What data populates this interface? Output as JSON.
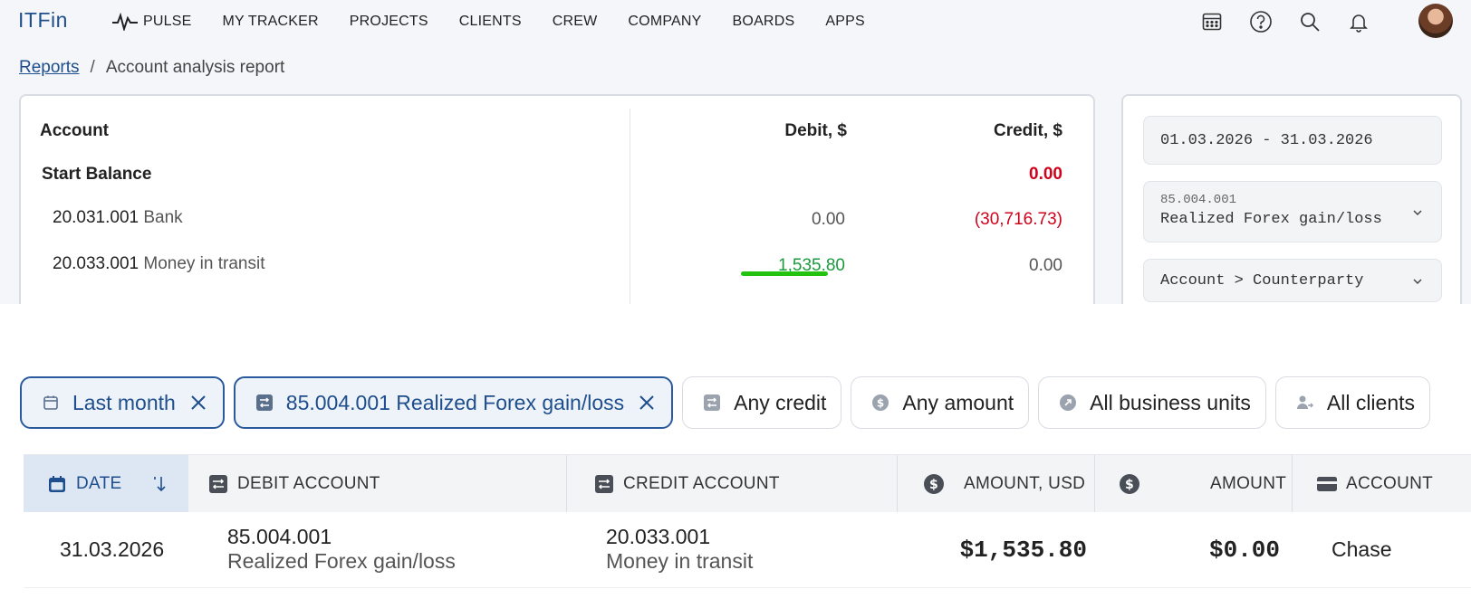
{
  "nav": {
    "logo": "ITFin",
    "items": [
      "PULSE",
      "MY TRACKER",
      "PROJECTS",
      "CLIENTS",
      "CREW",
      "COMPANY",
      "BOARDS",
      "APPS"
    ]
  },
  "breadcrumb": {
    "parent": "Reports",
    "separator": "/",
    "current": "Account analysis report"
  },
  "report": {
    "headers": {
      "account": "Account",
      "debit": "Debit, $",
      "credit": "Credit, $"
    },
    "start_balance": {
      "label": "Start Balance",
      "credit": "0.00"
    },
    "rows": [
      {
        "code": "20.031.001",
        "name": "Bank",
        "debit": "0.00",
        "credit": "(30,716.73)"
      },
      {
        "code": "20.033.001",
        "name": "Money in transit",
        "debit": "1,535.80",
        "credit": "0.00"
      }
    ]
  },
  "filters_panel": {
    "period": "01.03.2026 - 31.03.2026",
    "account_code": "85.004.001",
    "account_name": "Realized Forex gain/loss",
    "grouping": "Account > Counterparty"
  },
  "chips": [
    {
      "label": "Last month",
      "active": true,
      "icon": "calendar-icon"
    },
    {
      "label": "85.004.001 Realized Forex gain/loss",
      "active": true,
      "icon": "transfer-icon"
    },
    {
      "label": "Any credit",
      "active": false,
      "icon": "transfer-icon"
    },
    {
      "label": "Any amount",
      "active": false,
      "icon": "dollar-icon"
    },
    {
      "label": "All business units",
      "active": false,
      "icon": "arrow-circle-icon"
    },
    {
      "label": "All clients",
      "active": false,
      "icon": "users-icon"
    }
  ],
  "table": {
    "columns": {
      "date": "DATE",
      "debit_account": "DEBIT ACCOUNT",
      "credit_account": "CREDIT ACCOUNT",
      "amount_usd": "AMOUNT, USD",
      "amount": "AMOUNT",
      "account": "ACCOUNT"
    },
    "rows": [
      {
        "date": "31.03.2026",
        "debit_code": "85.004.001",
        "debit_name": "Realized Forex gain/loss",
        "credit_code": "20.033.001",
        "credit_name": "Money in transit",
        "amount_usd": "$1,535.80",
        "amount": "$0.00",
        "account": "Chase"
      }
    ]
  },
  "colors": {
    "brand": "#1e4e8c",
    "negative": "#d0021b",
    "positive": "#1a9a3c",
    "highlight": "#22c20f"
  }
}
